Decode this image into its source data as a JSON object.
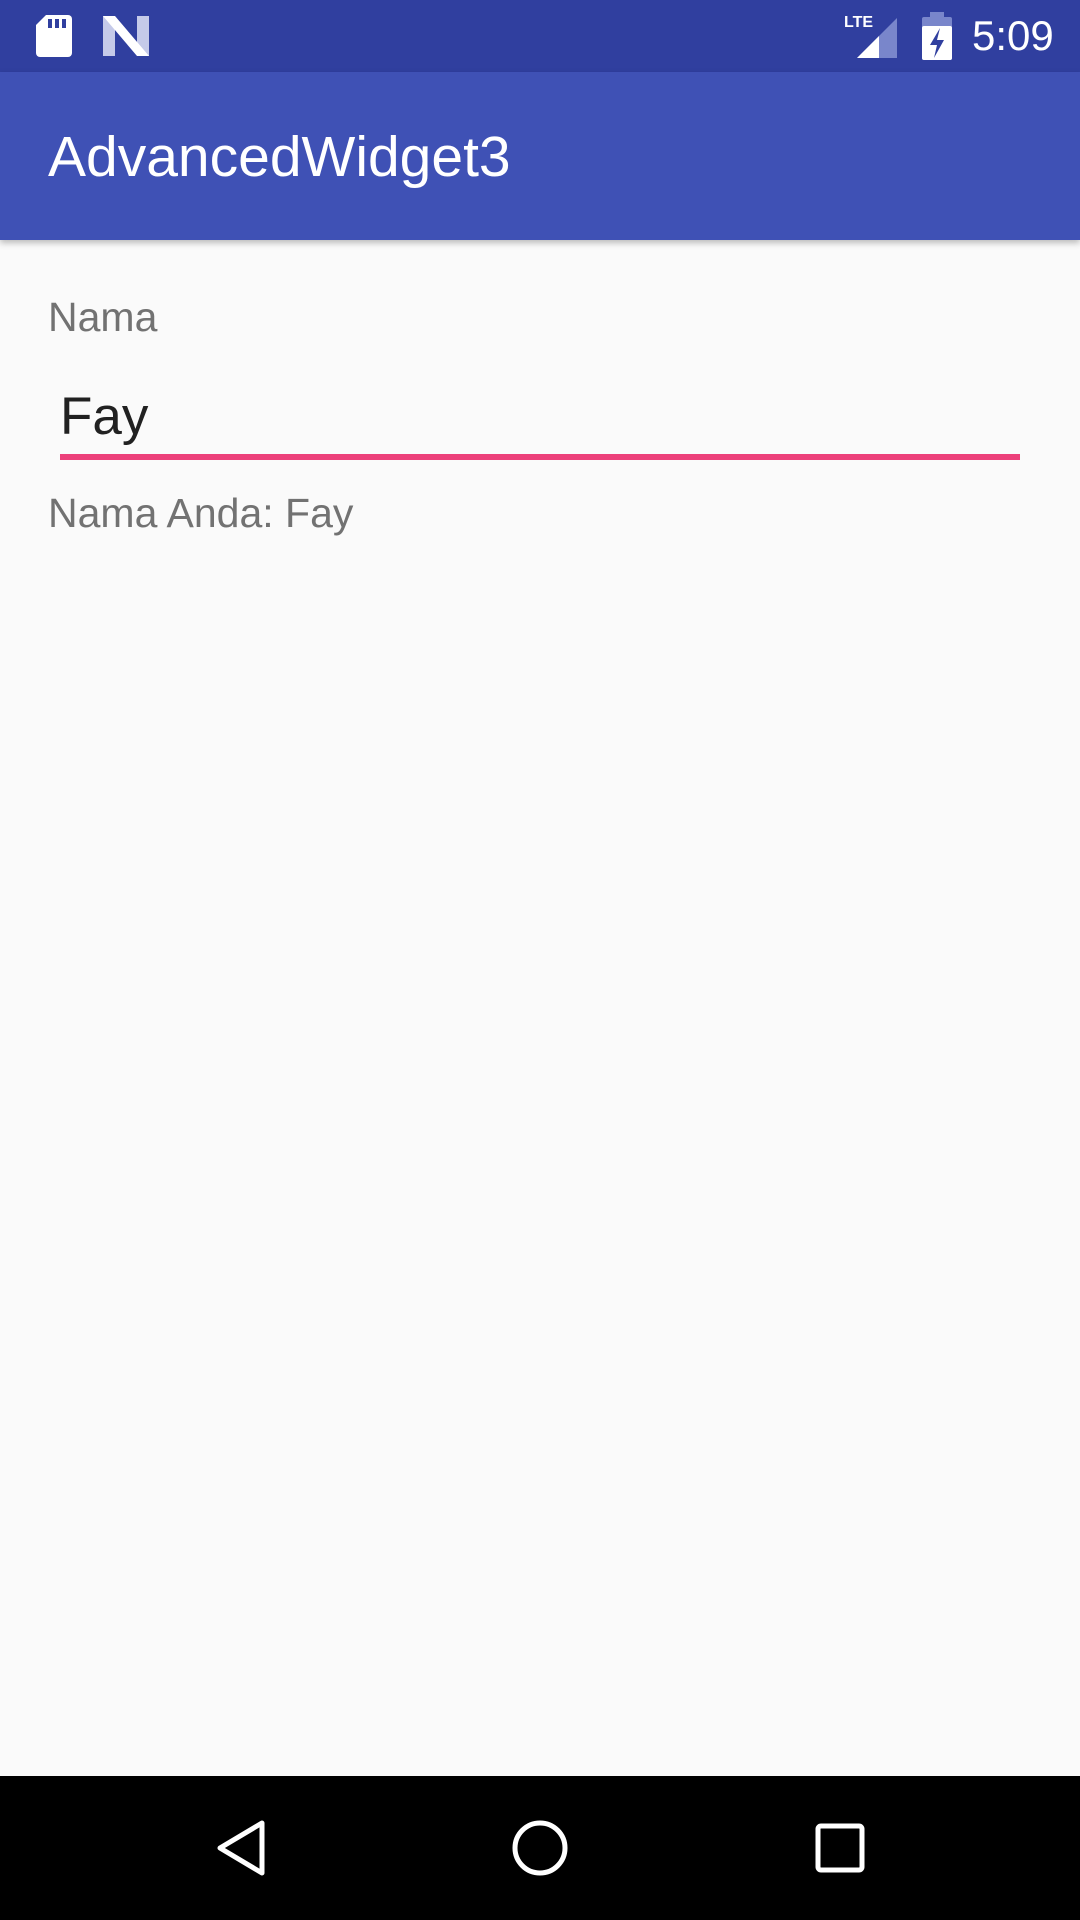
{
  "status_bar": {
    "time": "5:09",
    "icons": [
      "sd-card-icon",
      "n-logo-icon",
      "lte-signal-icon",
      "battery-charging-icon"
    ],
    "network": "LTE"
  },
  "app_bar": {
    "title": "AdvancedWidget3"
  },
  "form": {
    "name_label": "Nama",
    "name_value": "Fay",
    "result_text": "Nama Anda: Fay"
  },
  "nav_bar": {
    "buttons": [
      "back-icon",
      "home-icon",
      "recents-icon"
    ]
  },
  "colors": {
    "status_bar": "#303f9f",
    "app_bar": "#3f51b5",
    "accent": "#ec407a",
    "background": "#fafafa",
    "secondary_text": "#727272",
    "primary_text": "#212121"
  }
}
